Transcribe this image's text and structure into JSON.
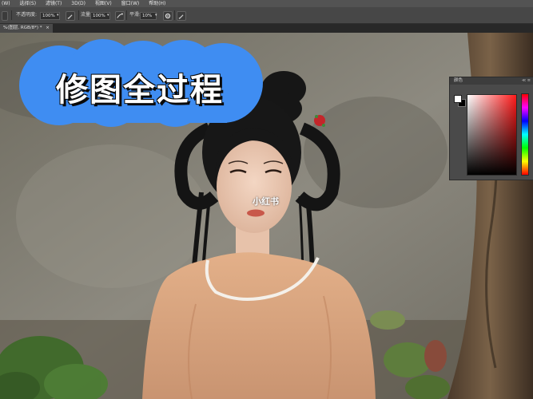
{
  "menu": {
    "items": [
      "(W)",
      "选择(S)",
      "滤镜(T)",
      "3D(D)",
      "视图(V)",
      "窗口(W)",
      "帮助(H)"
    ]
  },
  "options": {
    "opacity_label": "不透明度:",
    "opacity_value": "100%",
    "flow_label": "流量:",
    "flow_value": "100%",
    "smooth_label": "平滑:",
    "smooth_value": "10%"
  },
  "document": {
    "tab_label": "%(图层, RGB/8*) *"
  },
  "overlay": {
    "title": "修图全过程",
    "watermark": "小红书",
    "title_color": "#3f8df2"
  },
  "color_panel": {
    "title": "颜色",
    "controls": "≪ ≡",
    "foreground": "#ffffff",
    "background": "#000000"
  }
}
